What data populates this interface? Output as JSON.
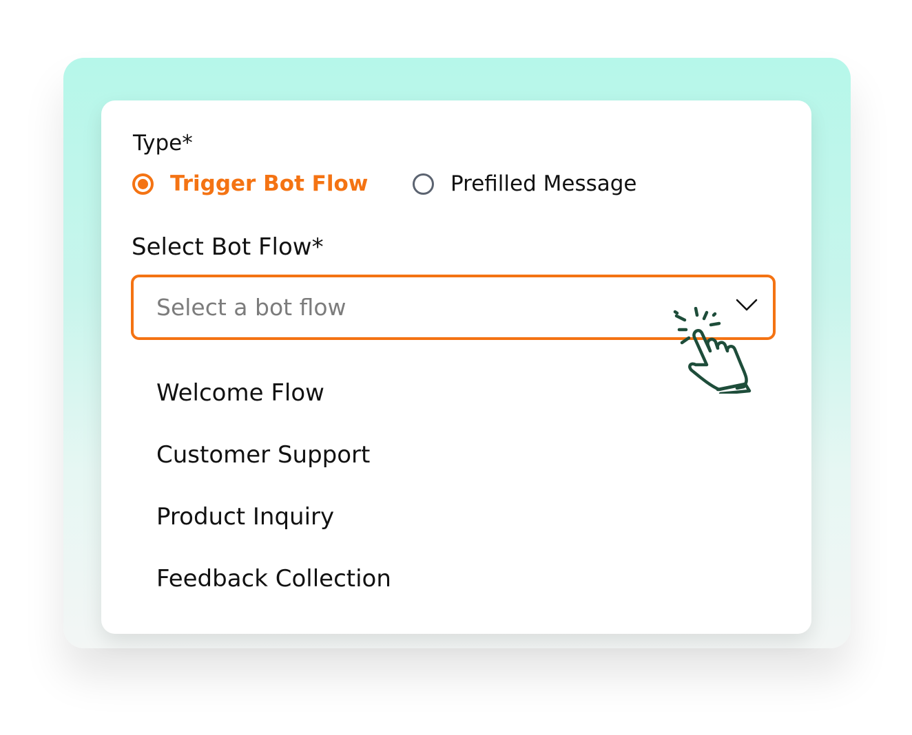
{
  "form": {
    "type_label": "Type*",
    "radio_options": [
      {
        "label": "Trigger Bot Flow",
        "selected": true
      },
      {
        "label": "Prefilled Message",
        "selected": false
      }
    ],
    "select_label": "Select Bot Flow*",
    "select_placeholder": "Select a bot flow",
    "dropdown_options": [
      "Welcome Flow",
      "Customer Support",
      "Product Inquiry",
      "Feedback Collection"
    ]
  },
  "colors": {
    "accent": "#f47313",
    "backdrop_mint": "#b6f7ea",
    "pointer": "#1e4d3a"
  },
  "icons": {
    "chevron": "chevron-down-icon",
    "pointer": "hand-pointer-icon"
  }
}
